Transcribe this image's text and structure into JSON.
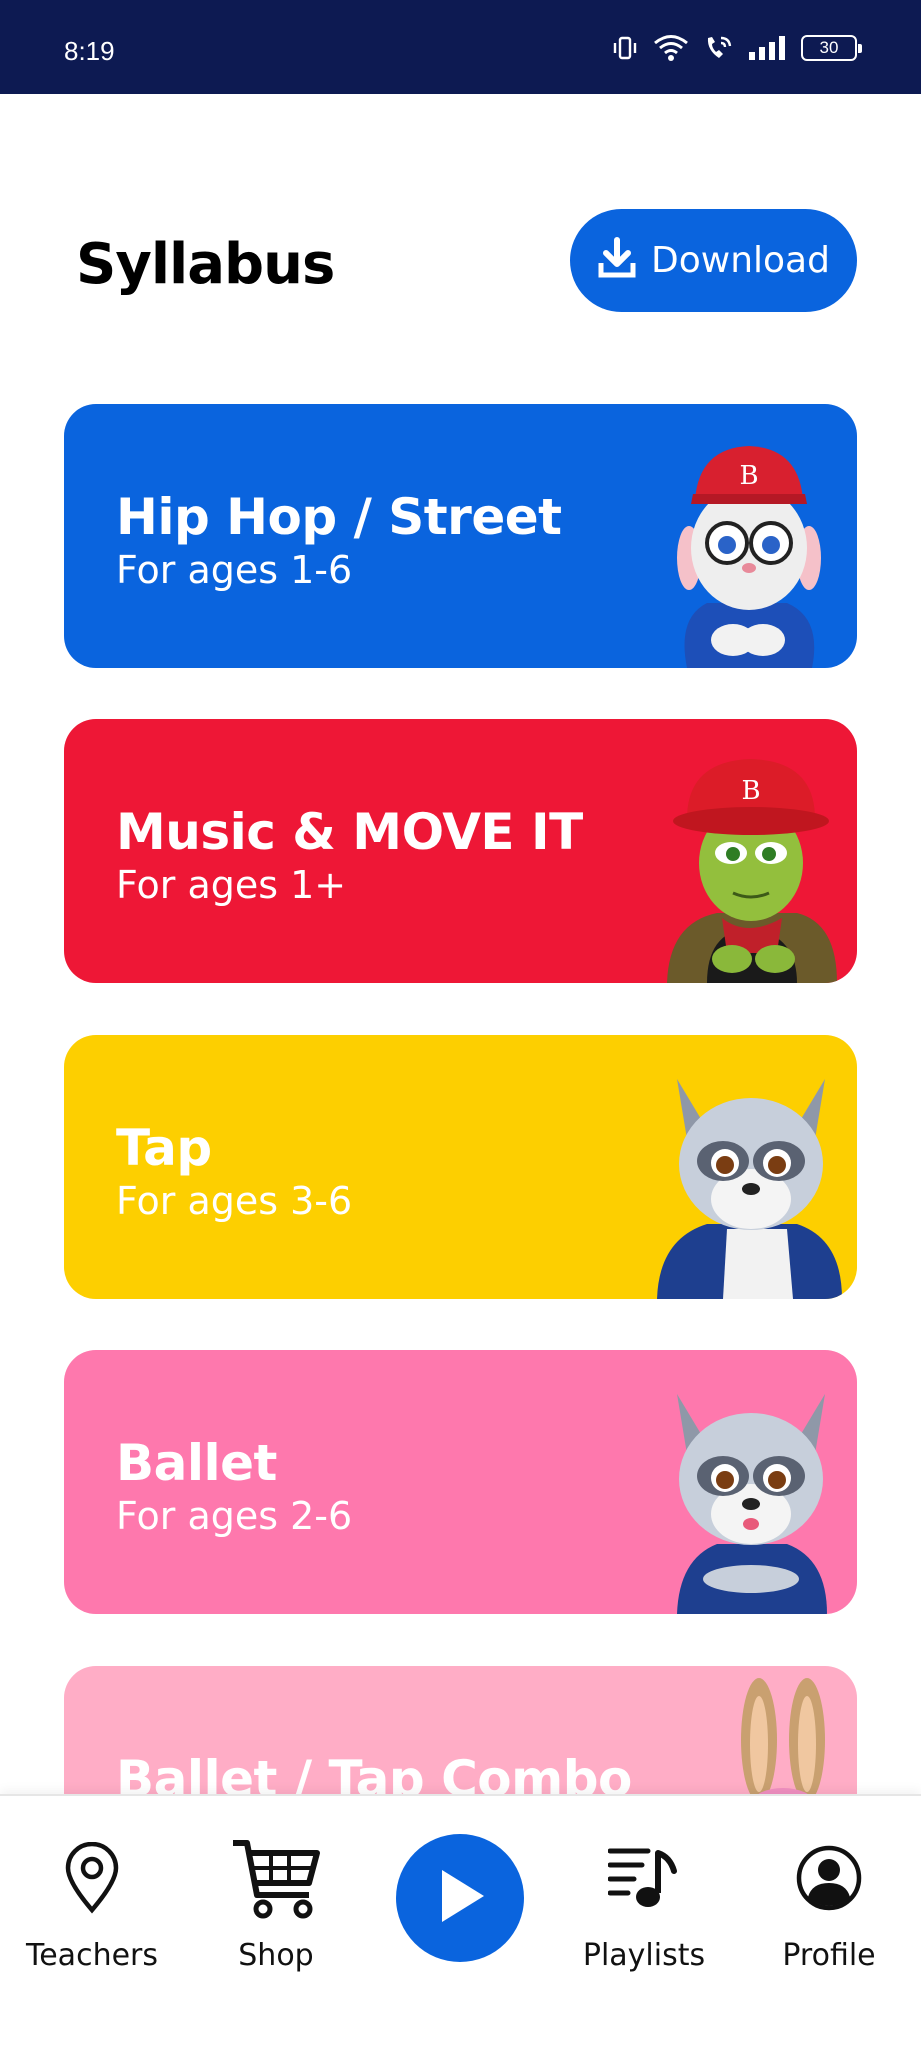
{
  "status_bar": {
    "time": "8:19",
    "battery_level": "30",
    "icons": [
      "vibrate-icon",
      "wifi-icon",
      "wifi-calling-icon",
      "signal-icon",
      "battery-icon"
    ]
  },
  "header": {
    "title": "Syllabus",
    "download_label": "Download",
    "download_icon": "download-icon"
  },
  "cards": [
    {
      "title": "Hip Hop / Street",
      "subtitle": "For ages 1-6",
      "color": "#0a64de",
      "character": "bunny-red-cap-glasses"
    },
    {
      "title": "Music & MOVE IT",
      "subtitle": "For ages 1+",
      "color": "#ee1736",
      "character": "turtle-red-bucket-hat"
    },
    {
      "title": "Tap",
      "subtitle": "For ages 3-6",
      "color": "#fdcf00",
      "character": "raccoon-blue-jacket"
    },
    {
      "title": "Ballet",
      "subtitle": "For ages 2-6",
      "color": "#fe78ad",
      "character": "raccoon-arms-crossed"
    },
    {
      "title": "Ballet / Tap Combo",
      "subtitle": "",
      "color": "#ffadc6",
      "character": "bunny-pink-bow"
    }
  ],
  "bottom_nav": {
    "items": [
      {
        "label": "Teachers",
        "icon": "location-pin-icon"
      },
      {
        "label": "Shop",
        "icon": "cart-icon"
      },
      {
        "label": "Playlists",
        "icon": "playlist-icon"
      },
      {
        "label": "Profile",
        "icon": "profile-icon"
      }
    ],
    "play_icon": "play-icon"
  },
  "colors": {
    "status_bar_bg": "#0d1a52",
    "accent": "#0a64de"
  }
}
